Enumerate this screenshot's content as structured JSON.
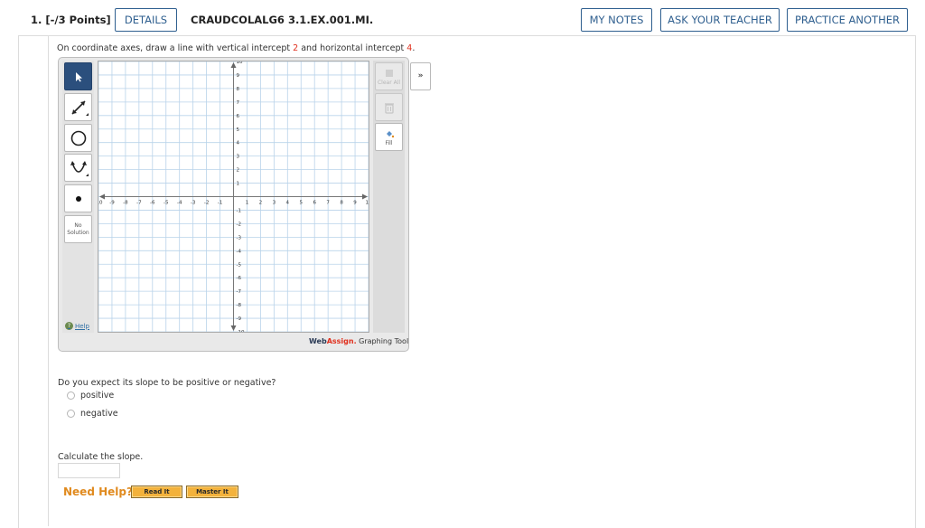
{
  "header": {
    "question_number": "1. [-/3 Points]",
    "details_label": "DETAILS",
    "question_id": "CRAUDCOLALG6 3.1.EX.001.MI.",
    "my_notes_label": "MY NOTES",
    "ask_teacher_label": "ASK YOUR TEACHER",
    "practice_another_label": "PRACTICE ANOTHER"
  },
  "prompt": {
    "before_v": "On coordinate axes, draw a line with vertical intercept ",
    "v_intercept": "2",
    "middle": " and horizontal intercept ",
    "h_intercept": "4",
    "after": "."
  },
  "graph_tool": {
    "tools": [
      "pointer",
      "line",
      "circle",
      "parabola",
      "point",
      "no-solution"
    ],
    "no_solution_label": "No Solution",
    "help_label": "Help",
    "right_tools": {
      "clear_label": "Clear All",
      "delete_label": "Delete",
      "fill_label": "Fill"
    },
    "collapse_label": "»",
    "brand_web": "Web",
    "brand_assign": "Assign.",
    "brand_suffix": " Graphing Tool",
    "axis": {
      "x_labels": [
        "-10",
        "-9",
        "-8",
        "-7",
        "-6",
        "-5",
        "-4",
        "-3",
        "-2",
        "-1",
        "1",
        "2",
        "3",
        "4",
        "5",
        "6",
        "7",
        "8",
        "9",
        "10"
      ],
      "y_labels": [
        "10",
        "9",
        "8",
        "7",
        "6",
        "5",
        "4",
        "3",
        "2",
        "1",
        "-1",
        "-2",
        "-3",
        "-4",
        "-5",
        "-6",
        "-7",
        "-8",
        "-9",
        "-10"
      ],
      "min": -10,
      "max": 10
    }
  },
  "slope_question": {
    "text": "Do you expect its slope to be positive or negative?",
    "options": [
      "positive",
      "negative"
    ]
  },
  "calc": {
    "text": "Calculate the slope.",
    "value": ""
  },
  "help": {
    "need_help_label": "Need Help?",
    "read_it_label": "Read It",
    "master_it_label": "Master It"
  }
}
